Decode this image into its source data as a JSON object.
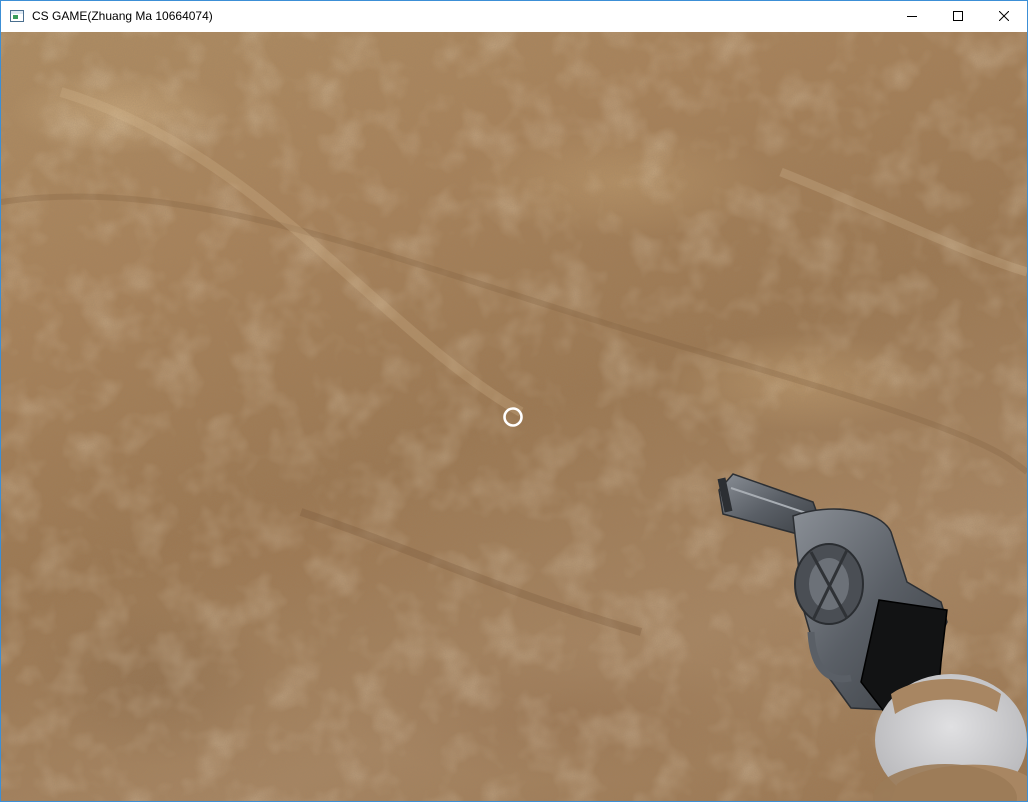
{
  "window": {
    "title": "CS GAME(Zhuang Ma 10664074)",
    "icon": "application-window-icon",
    "controls": [
      "minimize-icon",
      "maximize-icon",
      "close-icon"
    ]
  },
  "scene": {
    "ground": "dirt-terrain",
    "crosshair": "ring-crosshair",
    "weapon": "revolver"
  },
  "colors": {
    "ground": "#a98259",
    "crosshair": "#ffffff",
    "weapon_metal": "#5a5f66",
    "hand_wrap": "#c9c9cb"
  }
}
